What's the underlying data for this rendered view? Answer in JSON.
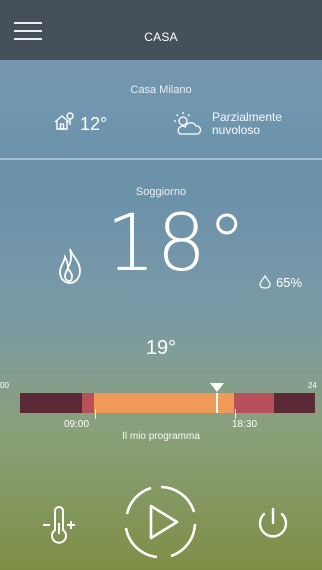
{
  "header": {
    "title": "CASA",
    "menu_icon": "hamburger-menu-icon"
  },
  "outdoor": {
    "location": "Casa Milano",
    "temperature": "12°",
    "weather": "Parzialmente nuvoloso",
    "home_icon": "home-thermometer-icon",
    "weather_icon": "partly-cloudy-icon"
  },
  "room": {
    "name": "Soggiorno",
    "current_temp": "18°",
    "humidity": "65%",
    "set_temp": "19°",
    "mode_icon": "flame-icon",
    "humidity_icon": "water-drop-icon"
  },
  "program": {
    "scale_start": "00",
    "scale_end": "24",
    "start_time": "09:00",
    "end_time": "18:30",
    "label": "Il mio programma"
  },
  "controls": {
    "thermostat_icon": "thermometer-adjust-icon",
    "play_icon": "play-icon",
    "power_icon": "power-icon"
  },
  "colors": {
    "topbar": "#46505a",
    "timeline_dark": "#5b2a36",
    "timeline_red": "#b6505a",
    "timeline_orange": "#ef9a58"
  }
}
